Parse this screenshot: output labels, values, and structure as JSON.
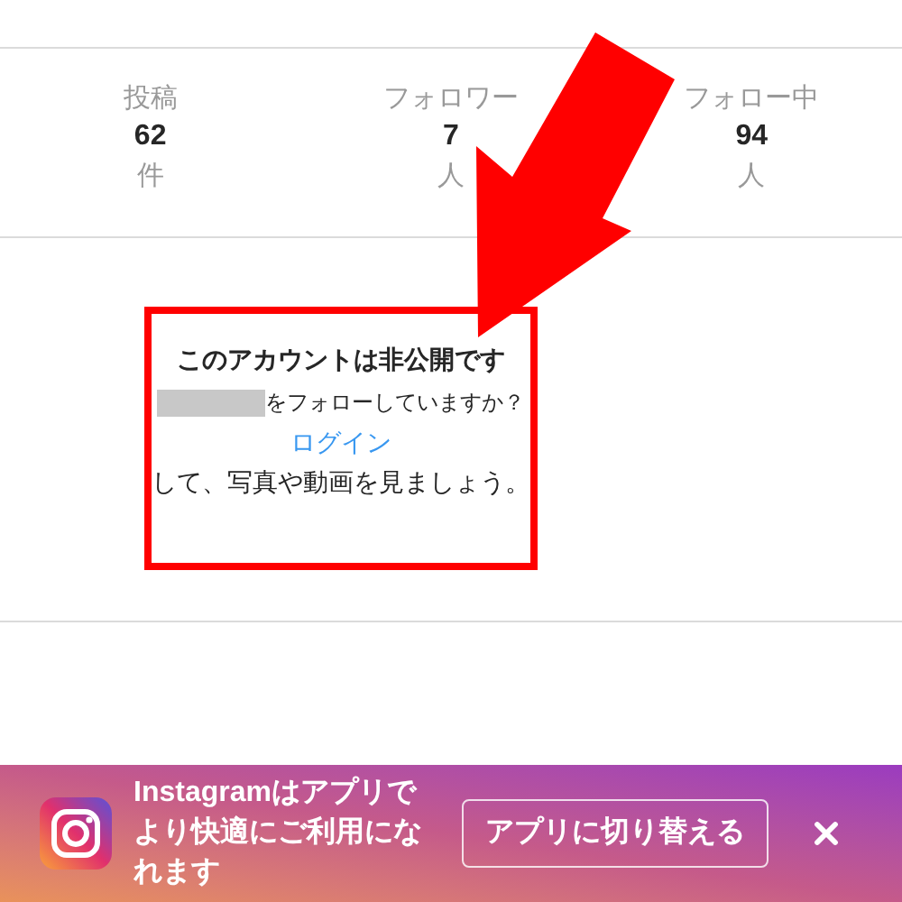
{
  "stats": [
    {
      "label": "投稿",
      "value": "62",
      "unit": "件"
    },
    {
      "label": "フォロワー",
      "value": "7",
      "unit": "人"
    },
    {
      "label": "フォロー中",
      "value": "94",
      "unit": "人"
    }
  ],
  "private_notice": {
    "title": "このアカウントは非公開です",
    "question": "をフォローしていますか？",
    "login_link": "ログイン",
    "message": "して、写真や動画を見ましょう。"
  },
  "app_banner": {
    "text": "Instagramはアプリでより快適にご利用になれます",
    "button": "アプリに切り替える"
  }
}
